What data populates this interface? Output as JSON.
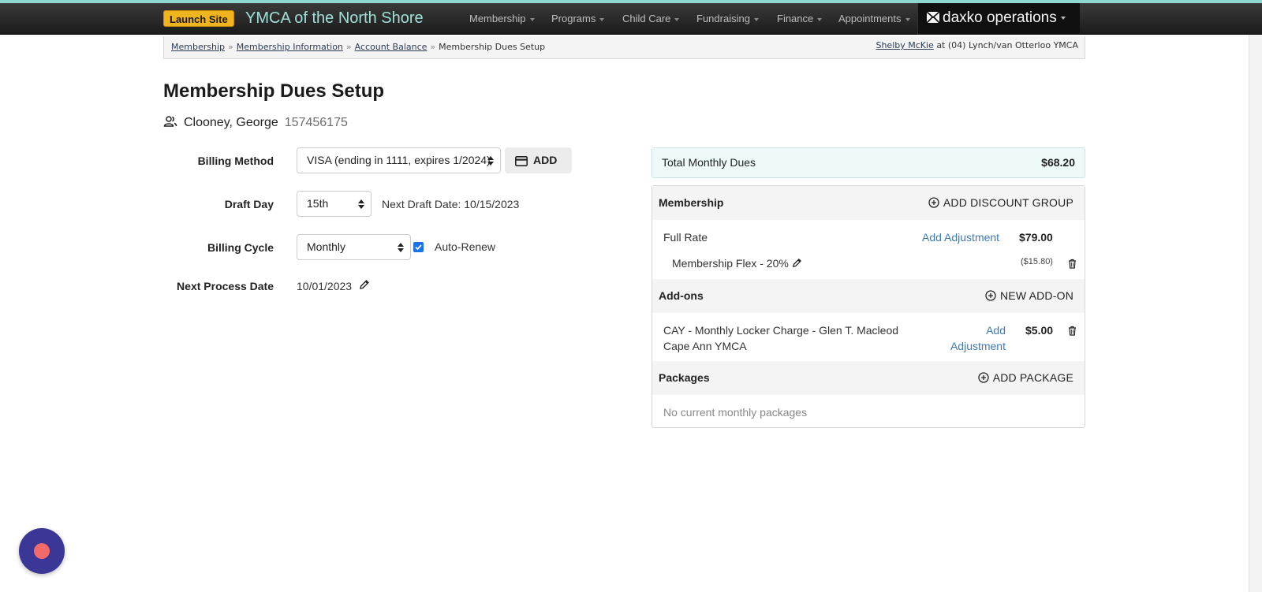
{
  "navbar": {
    "launch_label": "Launch Site",
    "brand": "YMCA of the North Shore",
    "menus": [
      "Membership",
      "Programs",
      "Child Care",
      "Fundraising",
      "Finance",
      "Appointments"
    ],
    "product": "daxko operations"
  },
  "breadcrumb": {
    "items": [
      "Membership",
      "Membership Information",
      "Account Balance"
    ],
    "current": "Membership Dues Setup",
    "user": "Shelby McKie",
    "location": "at (04) Lynch/van Otterloo YMCA"
  },
  "page": {
    "title": "Membership Dues Setup",
    "member_name": "Clooney, George",
    "member_id": "157456175"
  },
  "form": {
    "billing_method_label": "Billing Method",
    "billing_method_value": "VISA (ending in 1111, expires 1/2024)",
    "add_label": "ADD",
    "draft_day_label": "Draft Day",
    "draft_day_value": "15th",
    "next_draft": "Next Draft Date: 10/15/2023",
    "billing_cycle_label": "Billing Cycle",
    "billing_cycle_value": "Monthly",
    "auto_renew_label": "Auto-Renew",
    "auto_renew_checked": true,
    "next_process_label": "Next Process Date",
    "next_process_value": "10/01/2023"
  },
  "summary": {
    "total_label": "Total Monthly Dues",
    "total_value": "$68.20",
    "membership": {
      "header": "Membership",
      "action": "ADD DISCOUNT GROUP",
      "item_name": "Full Rate",
      "item_link": "Add Adjustment",
      "item_amount": "$79.00",
      "discount_name": "Membership Flex - 20%",
      "discount_amount": "($15.80)"
    },
    "addons": {
      "header": "Add-ons",
      "action": "NEW ADD-ON",
      "item_line1": "CAY - Monthly Locker Charge - Glen T. Macleod",
      "item_line2": "Cape Ann YMCA",
      "item_link_line1": "Add",
      "item_link_line2": "Adjustment",
      "item_amount": "$5.00"
    },
    "packages": {
      "header": "Packages",
      "action": "ADD PACKAGE",
      "empty": "No current monthly packages"
    }
  },
  "colors": {
    "accent_teal": "#9fe0d8",
    "launch_yellow": "#f0b41e",
    "link_blue": "#3d7ab8",
    "fab_purple": "#3b3796",
    "fab_dot": "#f26a6a"
  }
}
